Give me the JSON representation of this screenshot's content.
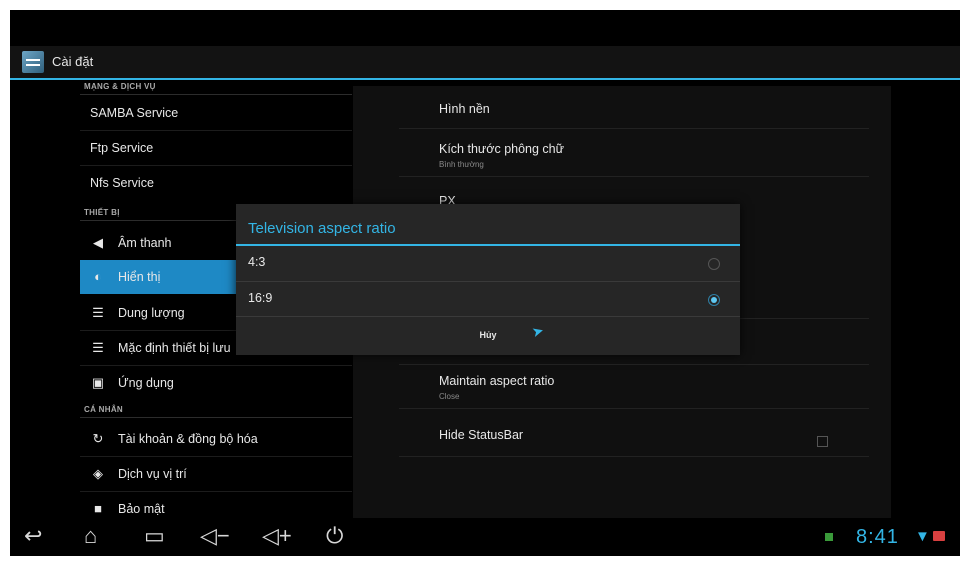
{
  "app": {
    "title": "Cài đặt",
    "icon": "settings-app-icon"
  },
  "sidebar": {
    "sections": [
      {
        "header": "MẠNG & DỊCH VỤ"
      },
      {
        "header": "THIẾT BỊ"
      },
      {
        "header": "CÁ NHÂN"
      }
    ],
    "items": [
      {
        "label": "SAMBA Service"
      },
      {
        "label": "Ftp Service"
      },
      {
        "label": "Nfs Service"
      },
      {
        "label": "Âm thanh",
        "icon": "speaker-icon"
      },
      {
        "label": "Hiển thị",
        "icon": "display-icon",
        "selected": true
      },
      {
        "label": "Dung lượng",
        "icon": "storage-icon"
      },
      {
        "label": "Mặc định thiết bị lưu",
        "icon": "storage-default-icon"
      },
      {
        "label": "Ứng dụng",
        "icon": "apps-icon"
      },
      {
        "label": "Tài khoản & đồng bộ hóa",
        "icon": "sync-icon"
      },
      {
        "label": "Dịch vụ vị trí",
        "icon": "location-icon"
      },
      {
        "label": "Bảo mật",
        "icon": "lock-icon"
      }
    ]
  },
  "settings": {
    "items": [
      {
        "title": "Hình nền",
        "summary": ""
      },
      {
        "title": "Kích thước phông chữ",
        "summary": "Bình thường"
      },
      {
        "title": "PX",
        "summary": ""
      },
      {
        "title": "Maintain aspect ratio",
        "summary": "Close"
      },
      {
        "title": "Hide StatusBar",
        "summary": "",
        "checkbox": false
      }
    ]
  },
  "dialog": {
    "title": "Television aspect ratio",
    "options": [
      {
        "label": "4:3",
        "selected": false
      },
      {
        "label": "16:9",
        "selected": true
      }
    ],
    "cancel_label": "Hủy"
  },
  "navbar": {
    "buttons": [
      "back-icon",
      "home-icon",
      "recent-apps-icon",
      "volume-down-icon",
      "volume-up-icon",
      "power-icon"
    ]
  },
  "status": {
    "time": "8:41",
    "accent": "#33b5e5"
  }
}
